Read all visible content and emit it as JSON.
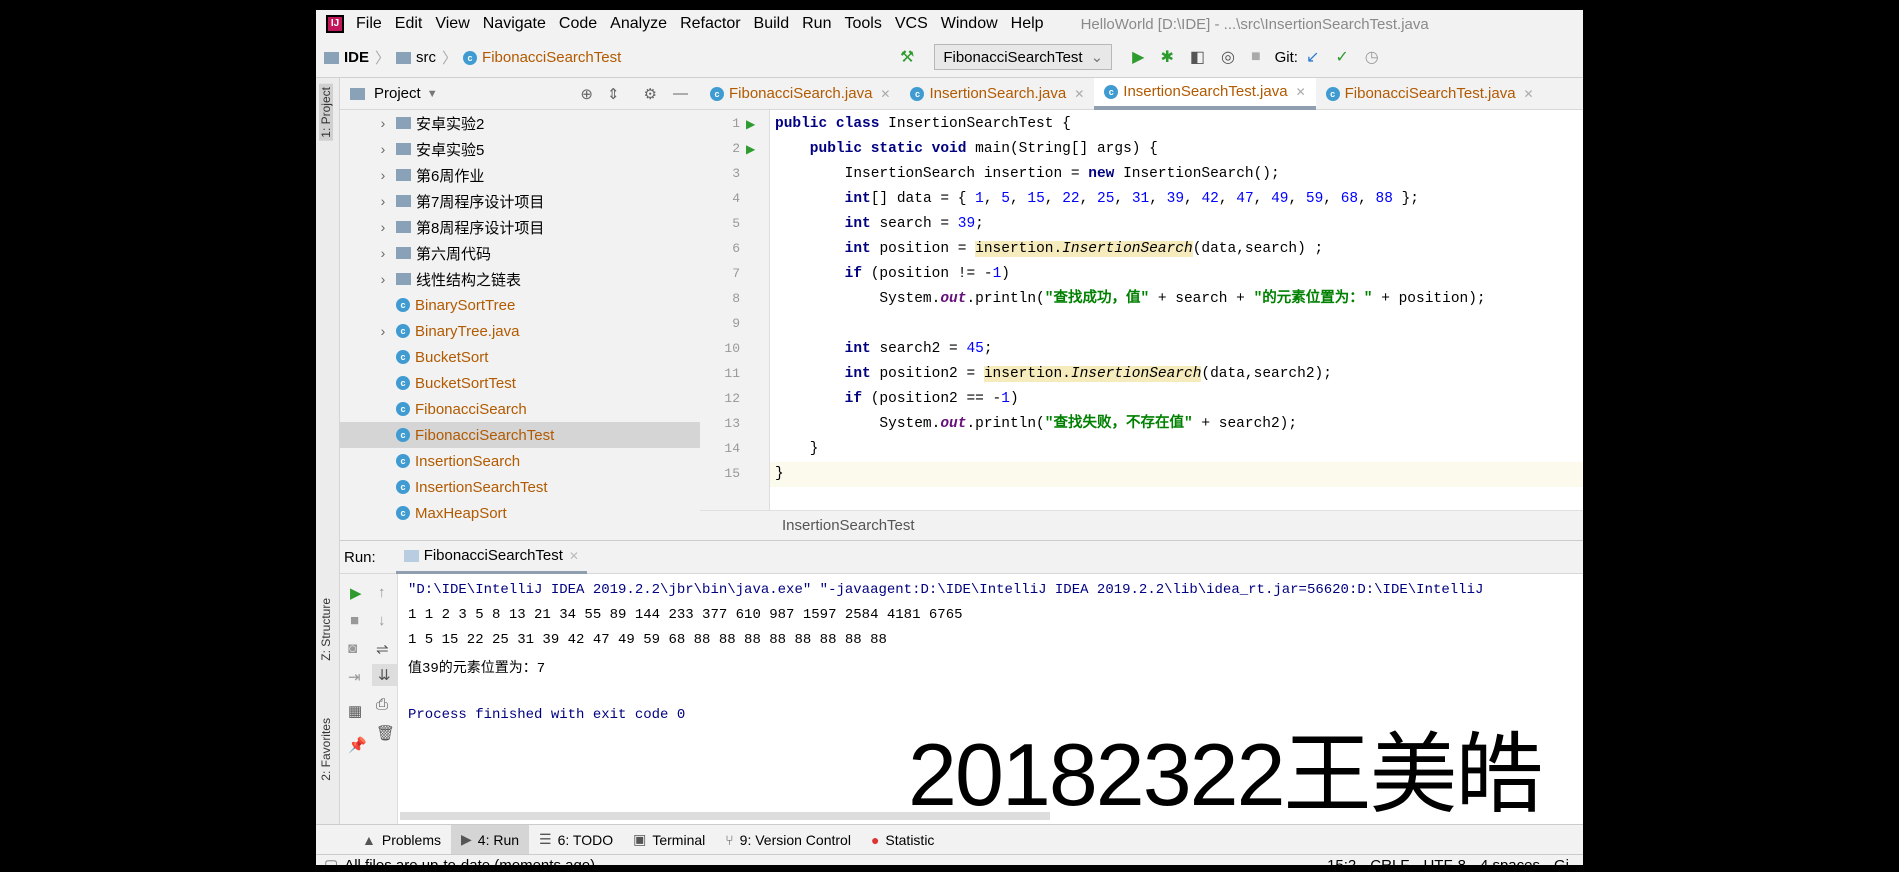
{
  "app": {
    "menu": [
      "File",
      "Edit",
      "View",
      "Navigate",
      "Code",
      "Analyze",
      "Refactor",
      "Build",
      "Run",
      "Tools",
      "VCS",
      "Window",
      "Help"
    ],
    "title": "HelloWorld [D:\\IDE] - ...\\src\\InsertionSearchTest.java"
  },
  "nav": {
    "breadcrumb": [
      "IDE",
      "src",
      "FibonacciSearchTest"
    ],
    "run_config": "FibonacciSearchTest",
    "git_label": "Git:"
  },
  "sidebar": {
    "project_label": "Project",
    "structure_label": "Z: Structure",
    "favorites_label": "2: Favorites",
    "strip_project": "1: Project"
  },
  "tree": [
    {
      "label": "安卓实验2",
      "type": "folder",
      "expandable": true
    },
    {
      "label": "安卓实验5",
      "type": "folder",
      "expandable": true
    },
    {
      "label": "第6周作业",
      "type": "folder",
      "expandable": true
    },
    {
      "label": "第7周程序设计项目",
      "type": "folder",
      "expandable": true
    },
    {
      "label": "第8周程序设计项目",
      "type": "folder",
      "expandable": true
    },
    {
      "label": "第六周代码",
      "type": "folder",
      "expandable": true
    },
    {
      "label": "线性结构之链表",
      "type": "folder",
      "expandable": true
    },
    {
      "label": "BinarySortTree",
      "type": "class"
    },
    {
      "label": "BinaryTree.java",
      "type": "class",
      "expandable": true
    },
    {
      "label": "BucketSort",
      "type": "class"
    },
    {
      "label": "BucketSortTest",
      "type": "class"
    },
    {
      "label": "FibonacciSearch",
      "type": "class"
    },
    {
      "label": "FibonacciSearchTest",
      "type": "class",
      "selected": true
    },
    {
      "label": "InsertionSearch",
      "type": "class"
    },
    {
      "label": "InsertionSearchTest",
      "type": "class"
    },
    {
      "label": "MaxHeapSort",
      "type": "class"
    }
  ],
  "tabs": [
    {
      "label": "FibonacciSearch.java"
    },
    {
      "label": "InsertionSearch.java"
    },
    {
      "label": "InsertionSearchTest.java",
      "active": true
    },
    {
      "label": "FibonacciSearchTest.java"
    }
  ],
  "code": [
    [
      [
        "public class ",
        "kw"
      ],
      [
        "InsertionSearchTest {",
        ""
      ]
    ],
    [
      [
        "    public static void ",
        "kw"
      ],
      [
        "main(String[] args) {",
        ""
      ]
    ],
    [
      [
        "        InsertionSearch insertion = ",
        ""
      ],
      [
        "new ",
        "kw"
      ],
      [
        "InsertionSearch();",
        ""
      ]
    ],
    [
      [
        "        ",
        ""
      ],
      [
        "int",
        "kw"
      ],
      [
        "[] data = { ",
        ""
      ],
      [
        "1",
        "num"
      ],
      [
        ", ",
        ""
      ],
      [
        "5",
        "num"
      ],
      [
        ", ",
        ""
      ],
      [
        "15",
        "num"
      ],
      [
        ", ",
        ""
      ],
      [
        "22",
        "num"
      ],
      [
        ", ",
        ""
      ],
      [
        "25",
        "num"
      ],
      [
        ", ",
        ""
      ],
      [
        "31",
        "num"
      ],
      [
        ", ",
        ""
      ],
      [
        "39",
        "num"
      ],
      [
        ", ",
        ""
      ],
      [
        "42",
        "num"
      ],
      [
        ", ",
        ""
      ],
      [
        "47",
        "num"
      ],
      [
        ", ",
        ""
      ],
      [
        "49",
        "num"
      ],
      [
        ", ",
        ""
      ],
      [
        "59",
        "num"
      ],
      [
        ", ",
        ""
      ],
      [
        "68",
        "num"
      ],
      [
        ", ",
        ""
      ],
      [
        "88",
        "num"
      ],
      [
        " };",
        ""
      ]
    ],
    [
      [
        "        ",
        ""
      ],
      [
        "int ",
        "kw"
      ],
      [
        "search = ",
        ""
      ],
      [
        "39",
        "num"
      ],
      [
        ";",
        ""
      ]
    ],
    [
      [
        "        ",
        ""
      ],
      [
        "int ",
        "kw"
      ],
      [
        "position = ",
        ""
      ],
      [
        "insertion.",
        "hl"
      ],
      [
        "InsertionSearch",
        "hl it"
      ],
      [
        "(data,search) ;",
        ""
      ]
    ],
    [
      [
        "        ",
        ""
      ],
      [
        "if ",
        "kw"
      ],
      [
        "(position != -",
        ""
      ],
      [
        "1",
        "num"
      ],
      [
        ")",
        ""
      ]
    ],
    [
      [
        "            System.",
        ""
      ],
      [
        "out",
        "fld"
      ],
      [
        ".println(",
        ""
      ],
      [
        "\"查找成功，值\"",
        "str"
      ],
      [
        " + search + ",
        ""
      ],
      [
        "\"的元素位置为：\"",
        "str"
      ],
      [
        " + position);",
        ""
      ]
    ],
    [],
    [
      [
        "        ",
        ""
      ],
      [
        "int ",
        "kw"
      ],
      [
        "search2 = ",
        ""
      ],
      [
        "45",
        "num"
      ],
      [
        ";",
        ""
      ]
    ],
    [
      [
        "        ",
        ""
      ],
      [
        "int ",
        "kw"
      ],
      [
        "position2 = ",
        ""
      ],
      [
        "insertion.",
        "hl"
      ],
      [
        "InsertionSearch",
        "hl it"
      ],
      [
        "(data,search2);",
        ""
      ]
    ],
    [
      [
        "        ",
        ""
      ],
      [
        "if ",
        "kw"
      ],
      [
        "(position2 == -",
        ""
      ],
      [
        "1",
        "num"
      ],
      [
        ")",
        ""
      ]
    ],
    [
      [
        "            System.",
        ""
      ],
      [
        "out",
        "fld"
      ],
      [
        ".println(",
        ""
      ],
      [
        "\"查找失败，不存在值\"",
        "str"
      ],
      [
        " + search2);",
        ""
      ]
    ],
    [
      [
        "    }",
        ""
      ]
    ],
    [
      [
        "}",
        ""
      ]
    ]
  ],
  "editor_breadcrumb": "InsertionSearchTest",
  "run": {
    "label": "Run:",
    "tab": "FibonacciSearchTest",
    "output": [
      {
        "text": "\"D:\\IDE\\IntelliJ IDEA 2019.2.2\\jbr\\bin\\java.exe\" \"-javaagent:D:\\IDE\\IntelliJ IDEA 2019.2.2\\lib\\idea_rt.jar=56620:D:\\IDE\\IntelliJ",
        "kind": "sys"
      },
      {
        "text": "1 1 2 3 5 8 13 21 34 55 89 144 233 377 610 987 1597 2584 4181 6765",
        "kind": ""
      },
      {
        "text": "1 5 15 22 25 31 39 42 47 49 59 68 88 88 88 88 88 88 88 88",
        "kind": ""
      },
      {
        "text": "值39的元素位置为：7",
        "kind": ""
      },
      {
        "text": "",
        "kind": ""
      },
      {
        "text": "Process finished with exit code 0",
        "kind": "sys"
      }
    ],
    "watermark": "20182322王美皓"
  },
  "toolwindows": [
    {
      "label": "Problems",
      "icon": "warning-icon"
    },
    {
      "label": "4: Run",
      "icon": "run-icon",
      "active": true
    },
    {
      "label": "6: TODO",
      "icon": "list-icon"
    },
    {
      "label": "Terminal",
      "icon": "terminal-icon"
    },
    {
      "label": "9: Version Control",
      "icon": "vcs-icon"
    },
    {
      "label": "Statistic",
      "icon": "statistic-icon"
    }
  ],
  "status": {
    "message": "All files are up-to-date (moments ago)",
    "position": "15:2",
    "line_sep": "CRLF",
    "encoding": "UTF-8",
    "indent": "4 spaces",
    "git": "Gi"
  }
}
